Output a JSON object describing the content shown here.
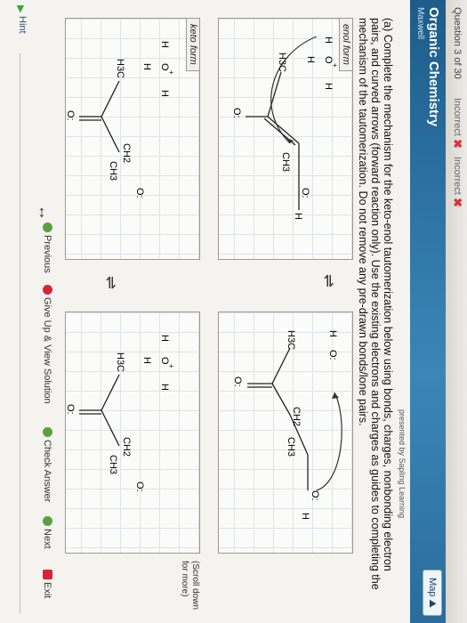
{
  "topbar": {
    "question": "Question 3 of 30",
    "attempts": [
      "Incorrect",
      "Incorrect"
    ],
    "x_mark": "✖"
  },
  "header": {
    "title": "Organic Chemistry",
    "author": "Maxwell",
    "presented_by": "presented by Sapling Learning",
    "map_label": "Map"
  },
  "question": {
    "text": "(a) Complete the mechanism for the keto-enol tautomerization below using bonds, charges, nonbonding electron pairs, and curved arrows (forward reaction only). Use the existing electrons and charges as guides to completing the mechanism of the tautomerization. Do not remove any pre-drawn bonds/lone pairs."
  },
  "panels": {
    "enol_label": "enol form",
    "keto_label": "keto form"
  },
  "molecules": {
    "h3o": [
      "H",
      "O",
      "+",
      "H",
      "H"
    ],
    "h3c": "H3C",
    "ch2": "CH2",
    "ch3": "CH3",
    "o": "O:",
    "h": "H"
  },
  "arrows": {
    "equilibrium": "⇌",
    "resonance": "↔"
  },
  "scroll_note": "(Scroll down for more)",
  "bottom": {
    "previous": "Previous",
    "give_up": "Give Up & View Solution",
    "check": "Check Answer",
    "next": "Next",
    "exit": "Exit"
  },
  "hint": "Hint"
}
